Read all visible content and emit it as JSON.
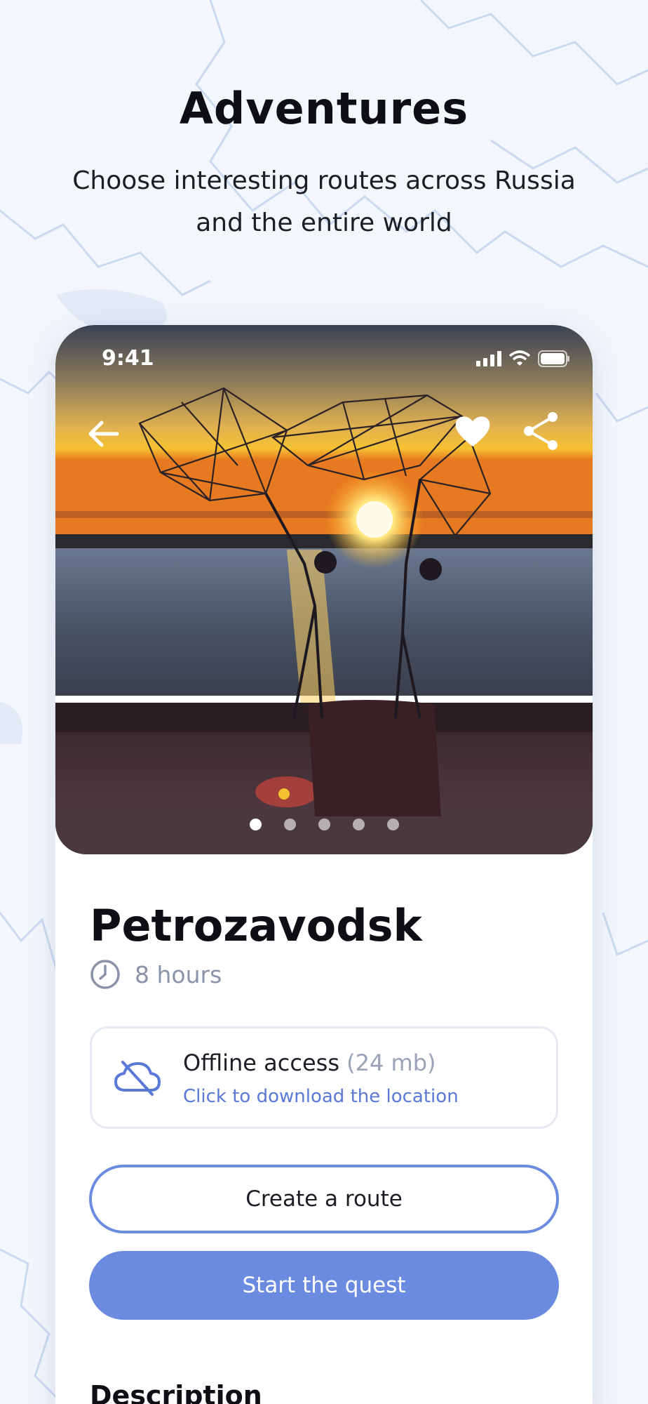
{
  "header": {
    "title": "Adventures",
    "subtitle": "Choose interesting routes across Russia and the entire world"
  },
  "status_bar": {
    "time": "9:41",
    "icons": [
      "signal-icon",
      "wifi-icon",
      "battery-icon"
    ]
  },
  "hero": {
    "image": "sunset-sculpture-photo",
    "slides_total": 5,
    "active_slide": 1,
    "actions": [
      "back-arrow-icon",
      "heart-icon",
      "share-icon"
    ]
  },
  "place": {
    "title": "Petrozavodsk",
    "duration": "8 hours"
  },
  "offline": {
    "title": "Offline access",
    "size": "(24 mb)",
    "link": "Click to download the location"
  },
  "buttons": {
    "create_route": "Create a route",
    "start_quest": "Start the quest"
  },
  "description": {
    "heading": "Description"
  },
  "colors": {
    "accent": "#6b8be0",
    "link": "#5a78d6",
    "muted": "#8a93a8",
    "background": "#f3f6fb"
  }
}
